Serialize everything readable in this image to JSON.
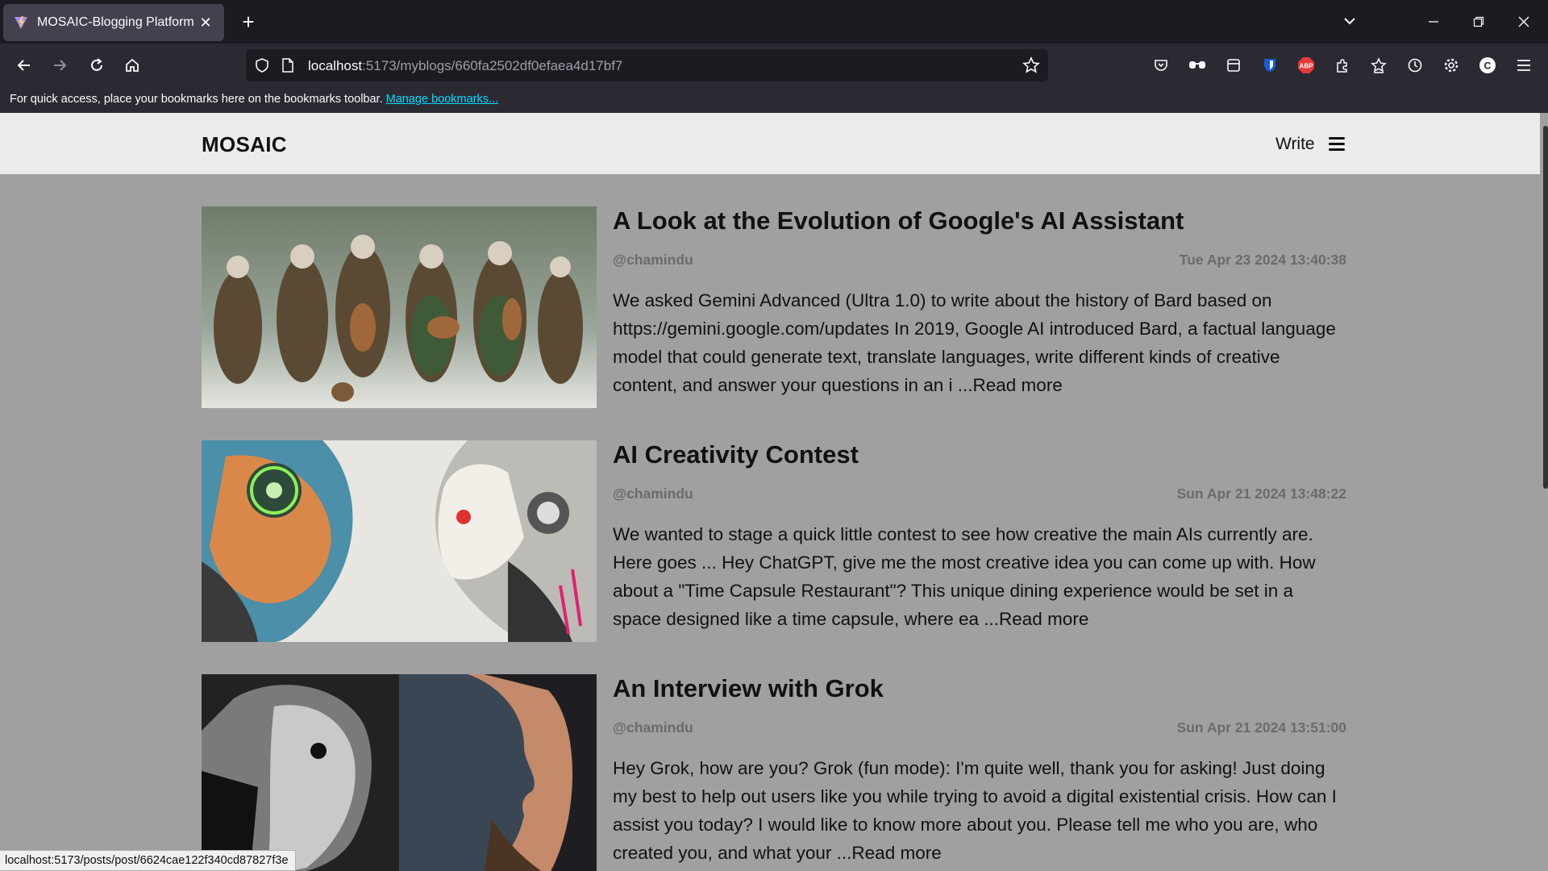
{
  "browser": {
    "tab_title": "MOSAIC-Blogging Platform",
    "url_host": "localhost",
    "url_rest": ":5173/myblogs/660fa2502df0efaea4d17bf7",
    "bookmarks_message": "For quick access, place your bookmarks here on the bookmarks toolbar.",
    "manage_bookmarks": "Manage bookmarks...",
    "status_url": "localhost:5173/posts/post/6624cae122f340cd87827f3e",
    "profile_initial": "C",
    "abp_label": "ABP"
  },
  "site": {
    "logo": "MOSAIC",
    "write_label": "Write"
  },
  "posts": [
    {
      "title": "A Look at the Evolution of Google's AI Assistant",
      "author": "@chamindu",
      "date": "Tue Apr 23 2024  13:40:38",
      "excerpt": "We asked Gemini Advanced (Ultra 1.0) to write about the history of Bard based on https://gemini.google.com/updates In 2019, Google AI introduced Bard, a factual language model that could generate text, translate languages, write different kinds of creative content, and answer your questions in an i ...Read more"
    },
    {
      "title": "AI Creativity Contest",
      "author": "@chamindu",
      "date": "Sun Apr 21 2024  13:48:22",
      "excerpt": "We wanted to stage a quick little contest to see how creative the main AIs currently are. Here goes ... Hey ChatGPT, give me the most creative idea you can come up with. How about a \"Time Capsule Restaurant\"? This unique dining experience would be set in a space designed like a time capsule, where ea ...Read more"
    },
    {
      "title": "An Interview with Grok",
      "author": "@chamindu",
      "date": "Sun Apr 21 2024  13:51:00",
      "excerpt": "Hey Grok, how are you? Grok (fun mode): I'm quite well, thank you for asking! Just doing my best to help out users like you while trying to avoid a digital existential crisis. How can I assist you today? I would like to know more about you. Please tell me who you are, who created you, and what your ...Read more"
    }
  ]
}
